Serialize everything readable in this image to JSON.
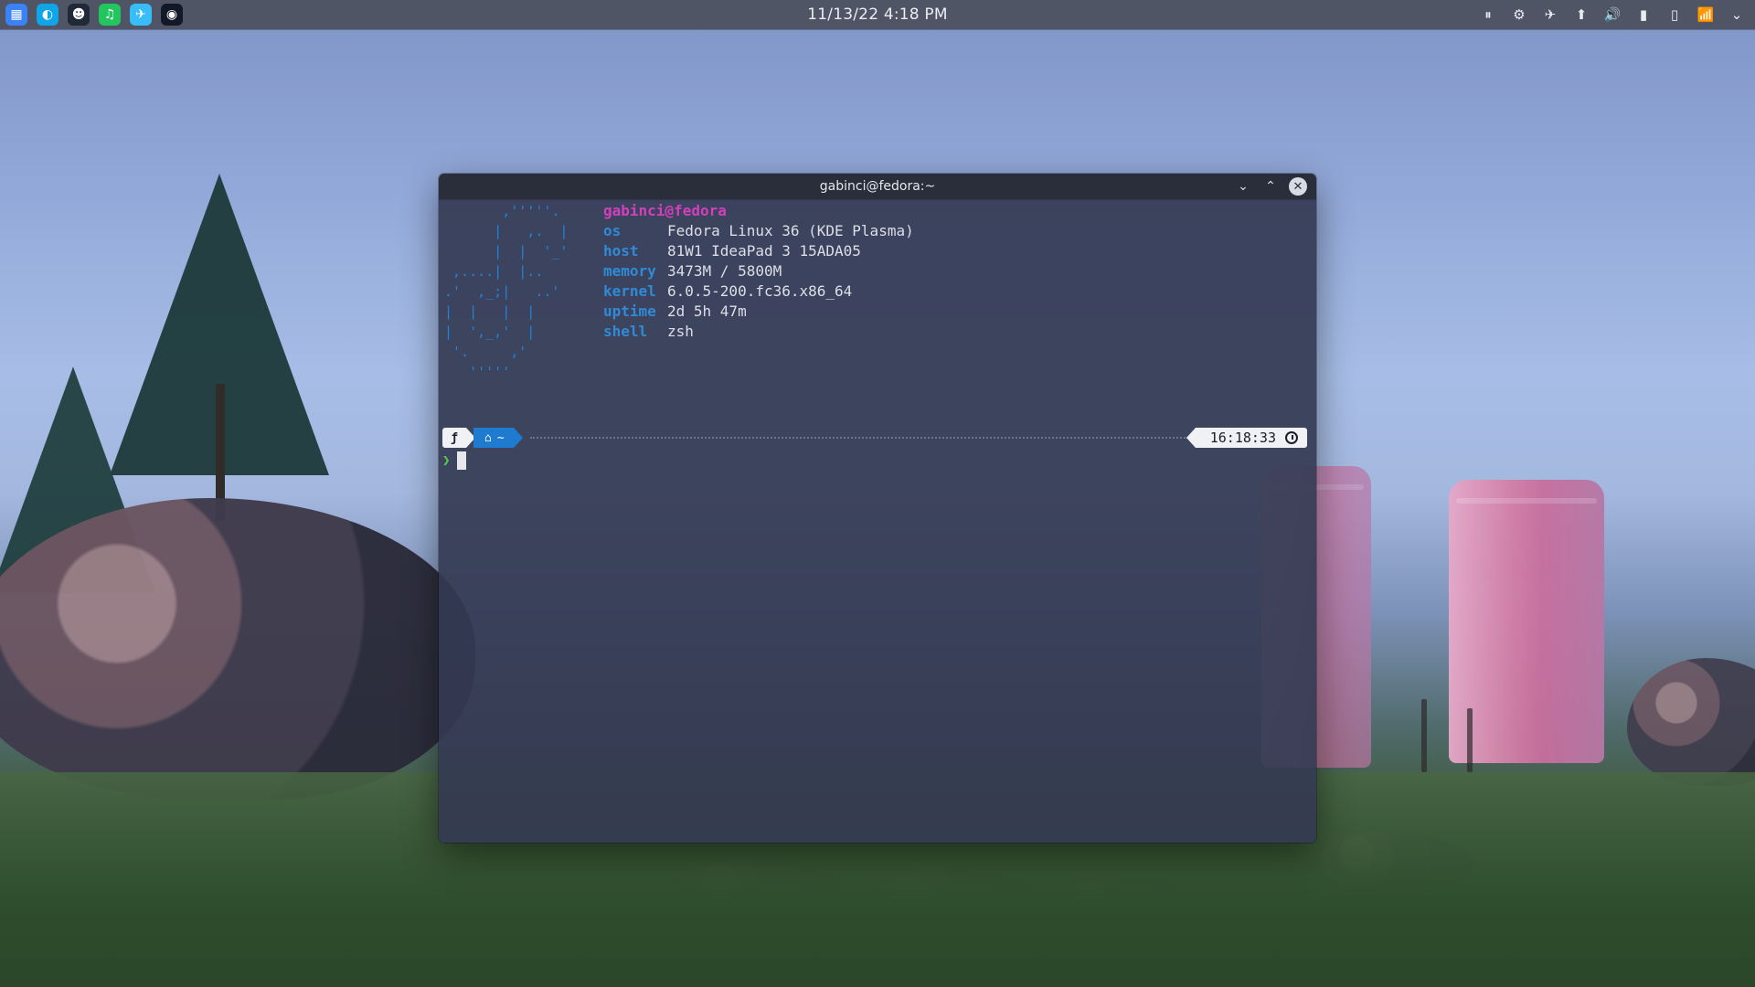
{
  "topbar": {
    "clock": "11/13/22  4:18 PM",
    "dock": [
      {
        "name": "start-menu-icon",
        "color": "#3b82f6",
        "glyph": "▦"
      },
      {
        "name": "browser-icon",
        "color": "#0ea5e9",
        "glyph": "◐"
      },
      {
        "name": "terminal-icon",
        "color": "#1f2937",
        "glyph": "☻"
      },
      {
        "name": "spotify-icon",
        "color": "#22c55e",
        "glyph": "♫"
      },
      {
        "name": "telegram-icon",
        "color": "#38bdf8",
        "glyph": "✈"
      },
      {
        "name": "obs-icon",
        "color": "#111827",
        "glyph": "◉"
      }
    ],
    "tray": [
      {
        "name": "media-pause-icon",
        "glyph": "⏸"
      },
      {
        "name": "steam-icon",
        "glyph": "⚙"
      },
      {
        "name": "telegram-tray-icon",
        "glyph": "✈"
      },
      {
        "name": "updates-icon",
        "glyph": "⬆"
      },
      {
        "name": "volume-icon",
        "glyph": "🔊"
      },
      {
        "name": "battery-icon",
        "glyph": "▮"
      },
      {
        "name": "device-icon",
        "glyph": "▯"
      },
      {
        "name": "wifi-icon",
        "glyph": "📶"
      },
      {
        "name": "tray-expand-icon",
        "glyph": "⌄"
      }
    ]
  },
  "window": {
    "title": "gabinci@fedora:~",
    "controls": {
      "minimize": "⌄",
      "maximize": "⌃",
      "close": "✕"
    }
  },
  "terminal": {
    "ascii_logo": "       ,'''''.\n      |   ,.  |\n      |  |  '_'\n ,....|  |..\n.'  ,_;|   ..'\n|  |   |  |\n|  ',_,'  |\n '.     ,'\n   '''''",
    "user_host": "gabinci@fedora",
    "info": [
      {
        "key": "os",
        "value": "Fedora Linux 36 (KDE Plasma)"
      },
      {
        "key": "host",
        "value": "81W1 IdeaPad 3 15ADA05"
      },
      {
        "key": "memory",
        "value": "3473M / 5800M"
      },
      {
        "key": "kernel",
        "value": "6.0.5-200.fc36.x86_64"
      },
      {
        "key": "uptime",
        "value": "2d 5h 47m"
      },
      {
        "key": "shell",
        "value": "zsh"
      }
    ],
    "prompt": {
      "os_glyph": "ƒ",
      "home_glyph": "⌂",
      "dir": "~",
      "time": "16:18:33",
      "caret": "❯"
    }
  },
  "colors": {
    "user": "#d33fbc",
    "key": "#2f8ad7",
    "home_segment": "#1f7bd0",
    "caret": "#59d04a"
  }
}
